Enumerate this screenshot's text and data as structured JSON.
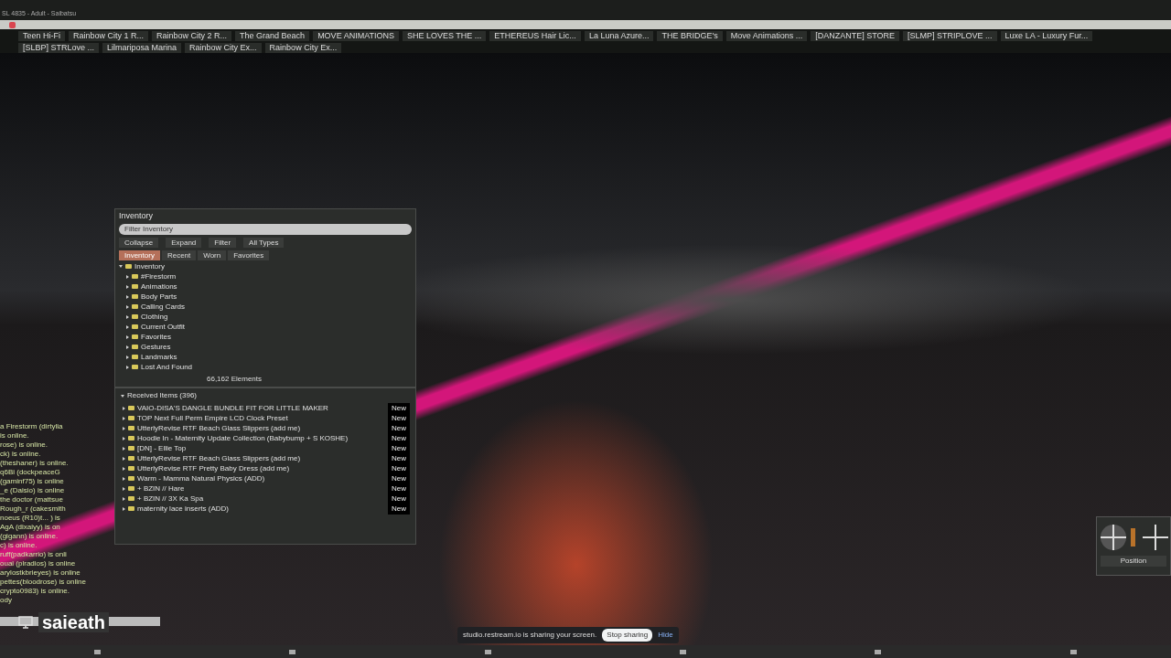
{
  "window": {
    "title": "SL 4835 - Adult - Saibatsu"
  },
  "favorites_bar": [
    "Teen Hi-Fi",
    "Rainbow City 1 R...",
    "Rainbow City 2 R...",
    "The Grand Beach",
    "MOVE ANIMATIONS",
    "SHE LOVES THE ...",
    "ETHEREUS Hair Lic...",
    "La Luna Azure...",
    "THE BRIDGE's",
    "Move Animations ...",
    "[DANZANTE] STORE",
    "[SLMP] STRIPLOVE ...",
    "Luxe LA - Luxury Fur...",
    "[SLBP] STRLove ...",
    "Lilmariposa Marina",
    "Rainbow City Ex...",
    "Rainbow City Ex..."
  ],
  "inventory": {
    "title": "Inventory",
    "search_placeholder": "Filter Inventory",
    "toolbar": [
      "Collapse",
      "Expand",
      "Filter",
      "All Types"
    ],
    "tabs": [
      {
        "label": "Inventory",
        "selected": true
      },
      {
        "label": "Recent",
        "selected": false
      },
      {
        "label": "Worn",
        "selected": false
      },
      {
        "label": "Favorites",
        "selected": false
      }
    ],
    "tree": {
      "label": "Inventory",
      "expanded": true,
      "children": [
        {
          "label": "#Firestorm",
          "expanded": false
        },
        {
          "label": "Animations",
          "expanded": false
        },
        {
          "label": "Body Parts",
          "expanded": false
        },
        {
          "label": "Calling Cards",
          "expanded": false
        },
        {
          "label": "Clothing",
          "expanded": false
        },
        {
          "label": "Current Outfit",
          "expanded": false
        },
        {
          "label": "Favorites",
          "expanded": false
        },
        {
          "label": "Gestures",
          "expanded": false
        },
        {
          "label": "Landmarks",
          "expanded": false
        },
        {
          "label": "Lost And Found",
          "expanded": false
        }
      ]
    },
    "status": "66,162 Elements"
  },
  "received_items": {
    "title": "Received Items (396)",
    "expanded": true,
    "items": [
      {
        "name": "VAIO-DISA'S DANGLE BUNDLE FIT FOR LITTLE MAKER",
        "badge": "New"
      },
      {
        "name": "TOP Next Full Perm Empire LCD Clock Preset",
        "badge": "New"
      },
      {
        "name": "UtterlyRevise RTF Beach Glass Slippers (add me)",
        "badge": "New"
      },
      {
        "name": "Hoodie In - Maternity Update Collection (Babybump + S KOSHE)",
        "badge": "New"
      },
      {
        "name": "[DN] - Ellie Top",
        "badge": "New"
      },
      {
        "name": "UtterlyRevise RTF Beach Glass Slippers (add me)",
        "badge": "New"
      },
      {
        "name": "UtterlyRevise RTF Pretty Baby Dress (add me)",
        "badge": "New"
      },
      {
        "name": "Warm - Mamma Natural Physics (ADD)",
        "badge": "New"
      },
      {
        "name": "+ BZIN // Hare",
        "badge": "New"
      },
      {
        "name": "+ BZIN // 3X Ka Spa",
        "badge": "New"
      },
      {
        "name": "maternity lace inserts (ADD)",
        "badge": "New"
      }
    ]
  },
  "chat": {
    "lines": [
      "a Firestorm (dirtylia",
      "is online.",
      "rose) is online.",
      "ck) is online.",
      "(theshaner) is online.",
      "q6Bi (dockpeaceG",
      "(gaminf75) is online",
      "_e (Daisio) is online",
      "the doctor (mattsue",
      "Rough_r (cakesmith",
      "noeus (R10)t... ) is",
      "AgA (dixaiyy) is on",
      "(gigann) is online.",
      "c) is online.",
      "ruff(padkarrio) is onli",
      "ouai (plradios) is online",
      "arylostkbrieyes) is online",
      "pettes(bloodrose) is online",
      "crypto0983) is online.",
      "ody"
    ]
  },
  "speaker": {
    "name": "saieath"
  },
  "screen_share": {
    "message": "studio.restream.io is sharing your screen.",
    "buttons": [
      "Stop sharing",
      "Hide"
    ]
  },
  "movement_controls": {
    "label": "Position"
  }
}
